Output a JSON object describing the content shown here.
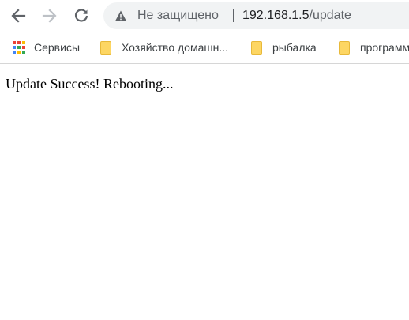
{
  "toolbar": {
    "back_icon": "arrow-left-icon",
    "forward_icon": "arrow-right-icon",
    "reload_icon": "reload-icon"
  },
  "omnibox": {
    "security_icon": "warning-triangle-icon",
    "security_text": "Не защищено",
    "url_host": "192.168.1.5",
    "url_path": "/update"
  },
  "bookmarks": [
    {
      "label": "Сервисы",
      "icon": "apps-grid-icon"
    },
    {
      "label": "Хозяйство домашн...",
      "icon": "folder-icon"
    },
    {
      "label": "рыбалка",
      "icon": "folder-icon"
    },
    {
      "label": "программ",
      "icon": "folder-icon"
    }
  ],
  "page": {
    "message": "Update Success! Rebooting..."
  },
  "colors": {
    "omnibox_bg": "#f1f3f4",
    "icon_gray": "#5f6368",
    "folder_yellow": "#fdd663",
    "folder_outline": "#e8b93a"
  }
}
